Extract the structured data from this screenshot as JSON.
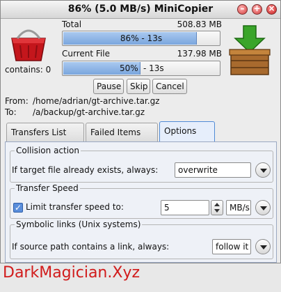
{
  "window": {
    "title": "86% (5.0 MB/s) MiniCopier"
  },
  "left": {
    "contains_label": "contains: 0"
  },
  "total": {
    "label": "Total",
    "size": "508.83 MB",
    "progress": 0.86,
    "progress_text": "86% - 13s"
  },
  "current": {
    "label": "Current File",
    "size": "137.98 MB",
    "progress": 0.5,
    "progress_pct": "50%",
    "progress_rest": "- 13s"
  },
  "controls": {
    "pause": "Pause",
    "skip": "Skip",
    "cancel": "Cancel"
  },
  "paths": {
    "from_label": "From:",
    "from": "/home/adrian/gt-archive.tar.gz",
    "to_label": "To:",
    "to": "/a/backup/gt-archive.tar.gz"
  },
  "tabs": [
    {
      "label": "Transfers List",
      "icon": "list-icon"
    },
    {
      "label": "Failed Items",
      "icon": "red-x-icon"
    },
    {
      "label": "Options",
      "icon": "tools-icon"
    }
  ],
  "options": {
    "collision": {
      "title": "Collision action",
      "label": "If target file already exists, always:",
      "value": "overwrite"
    },
    "speed": {
      "title": "Transfer Speed",
      "checkbox_label": "Limit transfer speed to:",
      "checked": true,
      "value": "5",
      "unit": "MB/s"
    },
    "symlinks": {
      "title": "Symbolic links (Unix systems)",
      "label": "If source path contains a link, always:",
      "value": "follow it"
    }
  },
  "watermark": "DarkMagician.Xyz",
  "colors": {
    "progress_fill": "#7aa6de",
    "active_tab": "#4f8ad6",
    "watermark": "#d11b1b"
  }
}
